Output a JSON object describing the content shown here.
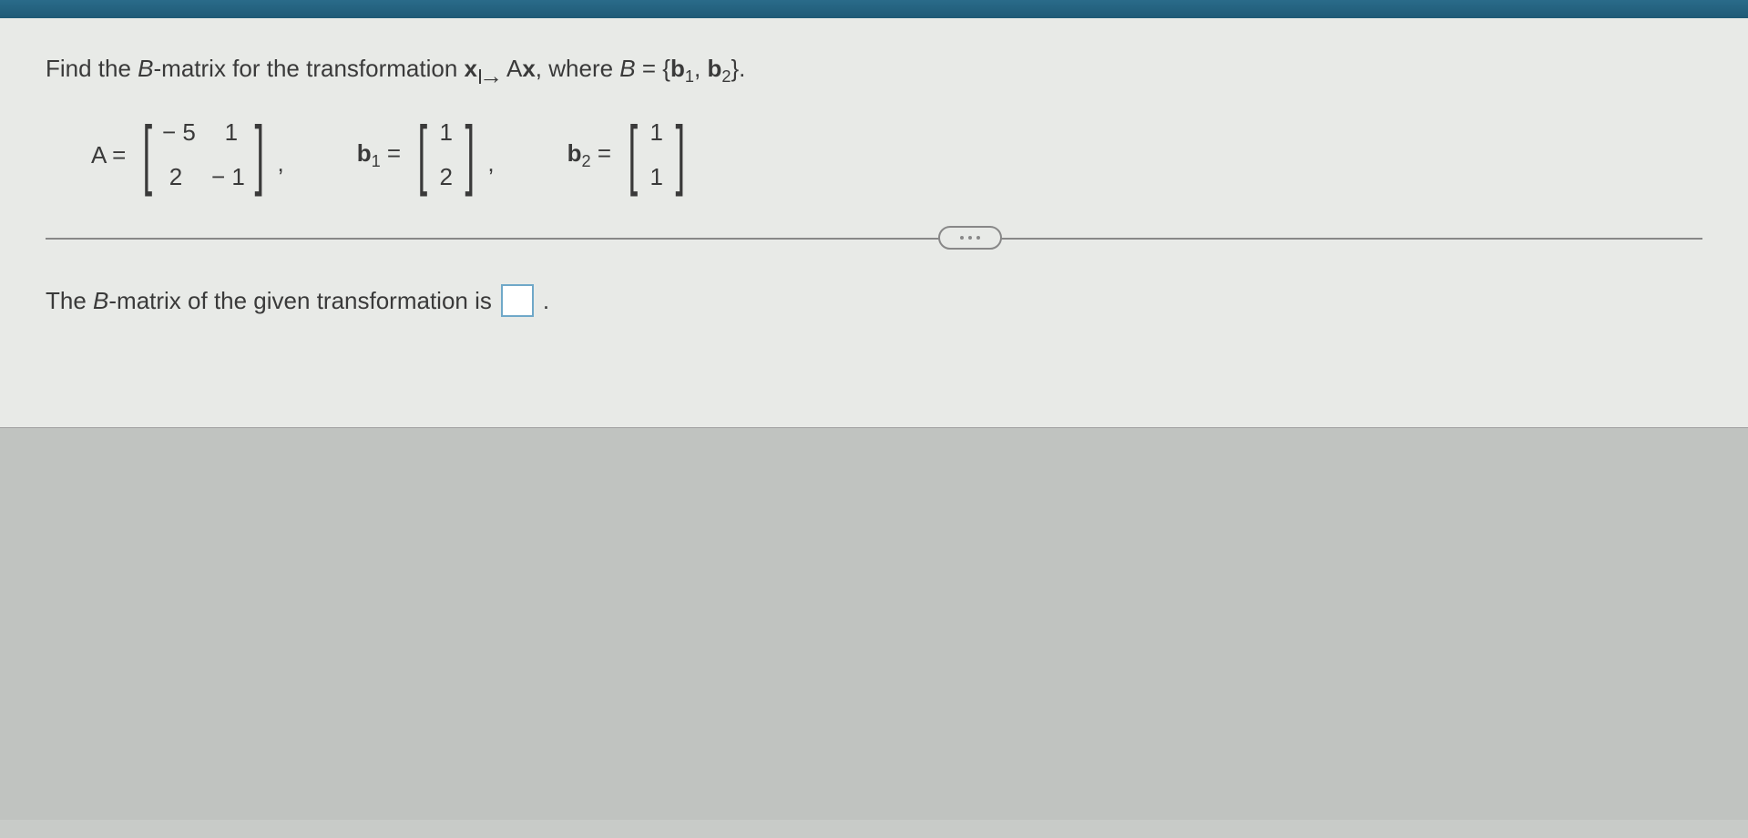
{
  "question": {
    "prefix": "Find the ",
    "italic1": "B",
    "mid1": "-matrix for the transformation ",
    "bold_x": "x",
    "mapsto_target_prefix": "A",
    "bold_x2": "x",
    "mid2": ", where ",
    "italic2": "B",
    "eq": " = {",
    "b": "b",
    "sub1": "1",
    "sep": ", ",
    "b2": "b",
    "sub2": "2",
    "close": "}."
  },
  "matrixA": {
    "label": "A =",
    "r1c1": "− 5",
    "r1c2": "1",
    "r2c1": "2",
    "r2c2": "− 1"
  },
  "vectorB1": {
    "label_b": "b",
    "label_sub": "1",
    "label_eq": " =",
    "v1": "1",
    "v2": "2"
  },
  "vectorB2": {
    "label_b": "b",
    "label_sub": "2",
    "label_eq": " =",
    "v1": "1",
    "v2": "1"
  },
  "answer": {
    "prefix": "The ",
    "italic": "B",
    "mid": "-matrix of the given transformation is",
    "suffix": "."
  }
}
